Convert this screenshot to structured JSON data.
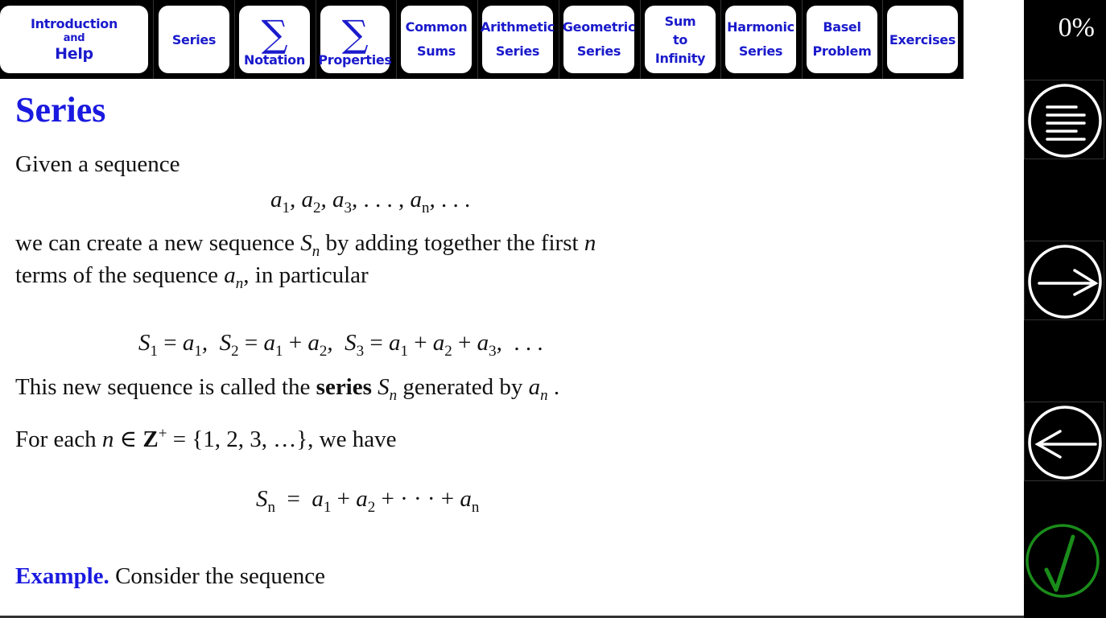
{
  "nav": {
    "items": [
      {
        "line1": "Introduction",
        "line2": "and",
        "line3": "Help"
      },
      {
        "label": "Series"
      },
      {
        "symbol": "∑",
        "label": "Notation"
      },
      {
        "symbol": "∑",
        "label": "Properties"
      },
      {
        "line1": "Common",
        "line2": "Sums"
      },
      {
        "line1": "Arithmetic",
        "line2": "Series"
      },
      {
        "line1": "Geometric",
        "line2": "Series"
      },
      {
        "line1": "Sum",
        "line2": "to",
        "line3": "Infinity"
      },
      {
        "line1": "Harmonic",
        "line2": "Series"
      },
      {
        "line1": "Basel",
        "line2": "Problem"
      },
      {
        "label": "Exercises"
      }
    ]
  },
  "sidebar": {
    "progress": "0%",
    "buttons": [
      "contents",
      "next",
      "previous",
      "check"
    ],
    "check_color": "#1a8c1a"
  },
  "page": {
    "title": "Series",
    "p1": "Given a sequence",
    "eq1": "a₁, a₂, a₃, … , aₙ, …",
    "p2a": "we can create a new sequence",
    "p2b": "by adding together the first",
    "p3a": "terms of the sequence",
    "p3b": ", in particular",
    "p4a": "This new sequence is called the",
    "p4kw": "series",
    "p4b": "generated by",
    "p5a": "For each",
    "p5b": "= {1, 2, 3, …}, we have",
    "example_label": "Example.",
    "example_text": "Consider the sequence",
    "accent_color": "#1a1ae0"
  }
}
